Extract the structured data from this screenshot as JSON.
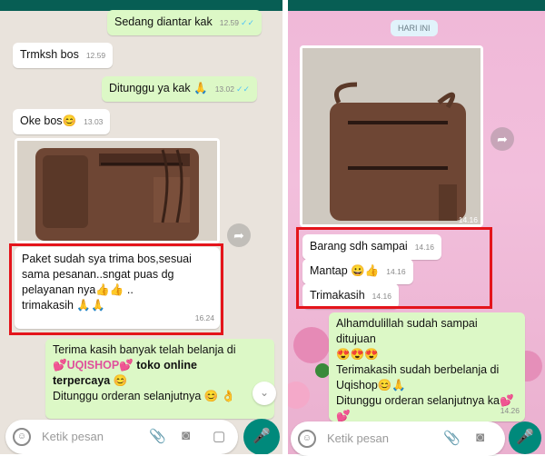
{
  "left_chat": {
    "messages": [
      {
        "id": "m1",
        "text": "Sedang diantar kak",
        "time": "12.59",
        "dir": "out"
      },
      {
        "id": "m2",
        "text": "Trmksh bos",
        "time": "12.59",
        "dir": "in"
      },
      {
        "id": "m3",
        "text": "Ditunggu ya kak 🙏",
        "time": "13.02",
        "dir": "out"
      },
      {
        "id": "m4",
        "text": "Oke bos😊",
        "time": "13.03",
        "dir": "in"
      }
    ],
    "highlight_message": {
      "line1": "Paket sudah sya trima bos,sesuai",
      "line2": "sama pesanan..sngat puas dg",
      "line3": "pelayanan nya👍👍 ..",
      "line4": "trimakasih 🙏🙏",
      "time": "16.24"
    },
    "seller_message": {
      "line1": "Terima kasih banyak telah belanja di",
      "shop_name": "💕UQISHOP💕",
      "tagline_a": "toko online",
      "tagline_b": "terpercaya",
      "emoji1": "😊",
      "line_last": "Ditunggu orderan selanjutnya 😊 👌"
    },
    "input_placeholder": "Ketik pesan"
  },
  "right_chat": {
    "date_chip": "HARI INI",
    "image_time": "14.16",
    "highlight_messages": [
      {
        "text": "Barang sdh sampai",
        "time": "14.16"
      },
      {
        "text": "Mantap 😀👍",
        "time": "14.16"
      },
      {
        "text": "Trimakasih",
        "time": "14.16"
      }
    ],
    "seller_message": {
      "line1": "Alhamdulillah sudah sampai ditujuan",
      "line2": "😍😍😍",
      "line3": "Terimakasih sudah berbelanja di",
      "line4": "Uqishop😊🙏",
      "line5": "Ditunggu orderan selanjutnya ka💕",
      "line6": "💕",
      "time": "14.26"
    },
    "input_placeholder": "Ketik pesan"
  },
  "colors": {
    "highlight": "#e4141b",
    "outgoing": "#dcf8c6",
    "incoming": "#ffffff",
    "fab": "#00897b"
  }
}
